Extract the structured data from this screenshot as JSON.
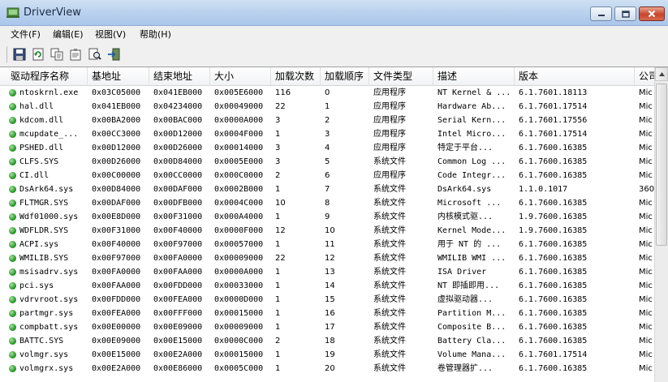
{
  "window": {
    "title": "DriverView",
    "icons": {
      "app": "driverview-app-icon",
      "minimize": "minimize-icon",
      "maximize": "maximize-icon",
      "close": "close-icon"
    }
  },
  "menu": [
    {
      "label": "文件(F)"
    },
    {
      "label": "编辑(E)"
    },
    {
      "label": "视图(V)"
    },
    {
      "label": "帮助(H)"
    }
  ],
  "toolbar": [
    {
      "icon": "save-icon"
    },
    {
      "icon": "refresh-icon"
    },
    {
      "icon": "copy-icon"
    },
    {
      "icon": "properties-icon"
    },
    {
      "icon": "find-icon"
    },
    {
      "icon": "exit-icon"
    }
  ],
  "columns": [
    "驱动程序名称",
    "基地址",
    "结束地址",
    "大小",
    "加载次数",
    "加载顺序",
    "文件类型",
    "描述",
    "版本",
    "公司"
  ],
  "rows": [
    [
      "ntoskrnl.exe",
      "0x03C05000",
      "0x041EB000",
      "0x005E6000",
      "116",
      "0",
      "应用程序",
      "NT Kernel & ...",
      "6.1.7601.18113",
      "Mic"
    ],
    [
      "hal.dll",
      "0x041EB000",
      "0x04234000",
      "0x00049000",
      "22",
      "1",
      "应用程序",
      "Hardware Ab...",
      "6.1.7601.17514",
      "Mic"
    ],
    [
      "kdcom.dll",
      "0x00BA2000",
      "0x00BAC000",
      "0x0000A000",
      "3",
      "2",
      "应用程序",
      "Serial Kern...",
      "6.1.7601.17556",
      "Mic"
    ],
    [
      "mcupdate_...",
      "0x00CC3000",
      "0x00D12000",
      "0x0004F000",
      "1",
      "3",
      "应用程序",
      "Intel Micro...",
      "6.1.7601.17514",
      "Mic"
    ],
    [
      "PSHED.dll",
      "0x00D12000",
      "0x00D26000",
      "0x00014000",
      "3",
      "4",
      "应用程序",
      "特定于平台...",
      "6.1.7600.16385",
      "Mic"
    ],
    [
      "CLFS.SYS",
      "0x00D26000",
      "0x00D84000",
      "0x0005E000",
      "3",
      "5",
      "系统文件",
      "Common Log ...",
      "6.1.7600.16385",
      "Mic"
    ],
    [
      "CI.dll",
      "0x00C00000",
      "0x00CC0000",
      "0x000C0000",
      "2",
      "6",
      "应用程序",
      "Code Integr...",
      "6.1.7600.16385",
      "Mic"
    ],
    [
      "DsArk64.sys",
      "0x00D84000",
      "0x00DAF000",
      "0x0002B000",
      "1",
      "7",
      "系统文件",
      "DsArk64.sys",
      "1.1.0.1017",
      "360"
    ],
    [
      "FLTMGR.SYS",
      "0x00DAF000",
      "0x00DFB000",
      "0x0004C000",
      "10",
      "8",
      "系统文件",
      "Microsoft ...",
      "6.1.7600.16385",
      "Mic"
    ],
    [
      "Wdf01000.sys",
      "0x00E8D000",
      "0x00F31000",
      "0x000A4000",
      "1",
      "9",
      "系统文件",
      "内核模式驱...",
      "1.9.7600.16385",
      "Mic"
    ],
    [
      "WDFLDR.SYS",
      "0x00F31000",
      "0x00F40000",
      "0x0000F000",
      "12",
      "10",
      "系统文件",
      "Kernel Mode...",
      "1.9.7600.16385",
      "Mic"
    ],
    [
      "ACPI.sys",
      "0x00F40000",
      "0x00F97000",
      "0x00057000",
      "1",
      "11",
      "系统文件",
      "用于 NT 的 ...",
      "6.1.7600.16385",
      "Mic"
    ],
    [
      "WMILIB.SYS",
      "0x00F97000",
      "0x00FA0000",
      "0x00009000",
      "22",
      "12",
      "系统文件",
      "WMILIB WMI ...",
      "6.1.7600.16385",
      "Mic"
    ],
    [
      "msisadrv.sys",
      "0x00FA0000",
      "0x00FAA000",
      "0x0000A000",
      "1",
      "13",
      "系统文件",
      "ISA Driver",
      "6.1.7600.16385",
      "Mic"
    ],
    [
      "pci.sys",
      "0x00FAA000",
      "0x00FDD000",
      "0x00033000",
      "1",
      "14",
      "系统文件",
      "NT 即插即用...",
      "6.1.7600.16385",
      "Mic"
    ],
    [
      "vdrvroot.sys",
      "0x00FDD000",
      "0x00FEA000",
      "0x0000D000",
      "1",
      "15",
      "系统文件",
      "虚拟驱动器...",
      "6.1.7600.16385",
      "Mic"
    ],
    [
      "partmgr.sys",
      "0x00FEA000",
      "0x00FFF000",
      "0x00015000",
      "1",
      "16",
      "系统文件",
      "Partition M...",
      "6.1.7600.16385",
      "Mic"
    ],
    [
      "compbatt.sys",
      "0x00E00000",
      "0x00E09000",
      "0x00009000",
      "1",
      "17",
      "系统文件",
      "Composite B...",
      "6.1.7600.16385",
      "Mic"
    ],
    [
      "BATTC.SYS",
      "0x00E09000",
      "0x00E15000",
      "0x0000C000",
      "2",
      "18",
      "系统文件",
      "Battery Cla...",
      "6.1.7600.16385",
      "Mic"
    ],
    [
      "volmgr.sys",
      "0x00E15000",
      "0x00E2A000",
      "0x00015000",
      "1",
      "19",
      "系统文件",
      "Volume Mana...",
      "6.1.7601.17514",
      "Mic"
    ],
    [
      "volmgrx.sys",
      "0x00E2A000",
      "0x00E86000",
      "0x0005C000",
      "1",
      "20",
      "系统文件",
      "卷管理器扩...",
      "6.1.7600.16385",
      "Mic"
    ]
  ]
}
